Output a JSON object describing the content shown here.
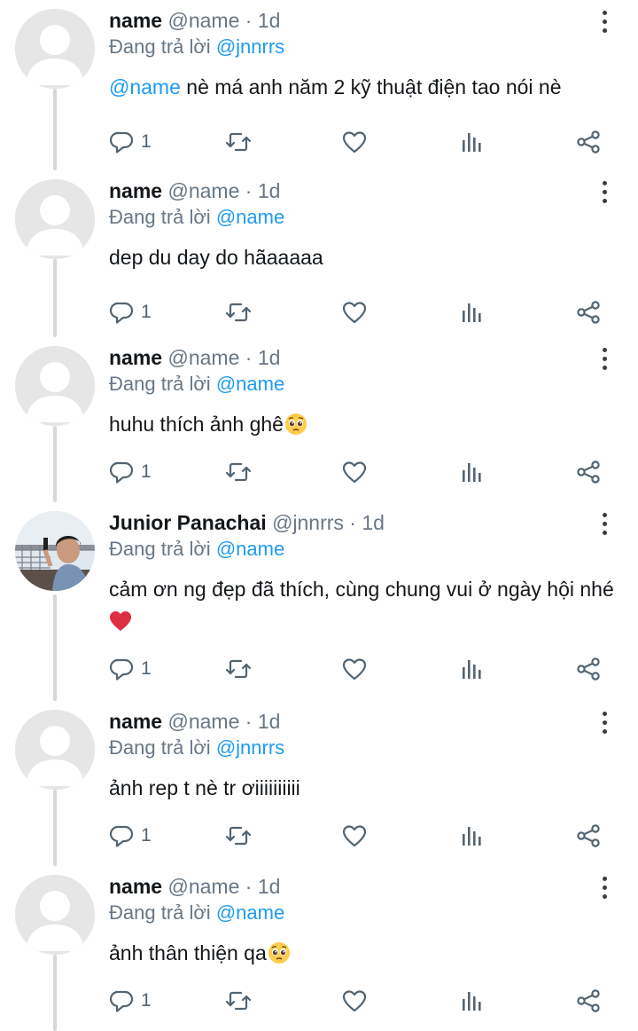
{
  "thread": {
    "posts": [
      {
        "name": "name",
        "handle": "@name",
        "time": "1d",
        "replying_prefix": "Đang trả lời",
        "replying_to": "@jnnrrs",
        "body_mention": "@name",
        "body": " nè má anh năm 2 kỹ thuật điện tao nói nè",
        "emoji": "",
        "reply_count": "1",
        "avatar": "default-avatar"
      },
      {
        "name": "name",
        "handle": "@name",
        "time": "1d",
        "replying_prefix": "Đang trả lời",
        "replying_to": "@name",
        "body_mention": "",
        "body": "dep du day do hãaaaaa",
        "emoji": "",
        "reply_count": "1",
        "avatar": "default-avatar"
      },
      {
        "name": "name",
        "handle": "@name",
        "time": "1d",
        "replying_prefix": "Đang trả lời",
        "replying_to": "@name",
        "body_mention": "",
        "body": "huhu thích ảnh ghê",
        "emoji": "pleading-face",
        "reply_count": "1",
        "avatar": "default-avatar"
      },
      {
        "name": "Junior Panachai",
        "handle": "@jnnrrs",
        "time": "1d",
        "replying_prefix": "Đang trả lời",
        "replying_to": "@name",
        "body_mention": "",
        "body": "cảm ơn ng đẹp đã thích, cùng chung vui ở ngày hội nhé",
        "emoji": "red-heart",
        "reply_count": "1",
        "avatar": "photo-avatar"
      },
      {
        "name": "name",
        "handle": "@name",
        "time": "1d",
        "replying_prefix": "Đang trả lời",
        "replying_to": "@jnnrrs",
        "body_mention": "",
        "body": "ảnh rep t nè tr ơiiiiiiiiii",
        "emoji": "",
        "reply_count": "1",
        "avatar": "default-avatar"
      },
      {
        "name": "name",
        "handle": "@name",
        "time": "1d",
        "replying_prefix": "Đang trả lời",
        "replying_to": "@name",
        "body_mention": "",
        "body": "ảnh thân thiện qa",
        "emoji": "pleading-face",
        "reply_count": "1",
        "avatar": "default-avatar"
      }
    ]
  },
  "colors": {
    "mention": "#1d9bf0",
    "meta": "#687785",
    "icon": "#536471",
    "thread_line": "#d8d8d8"
  },
  "icons": [
    "reply-icon",
    "retweet-icon",
    "like-icon",
    "views-icon",
    "share-icon",
    "more-icon"
  ]
}
